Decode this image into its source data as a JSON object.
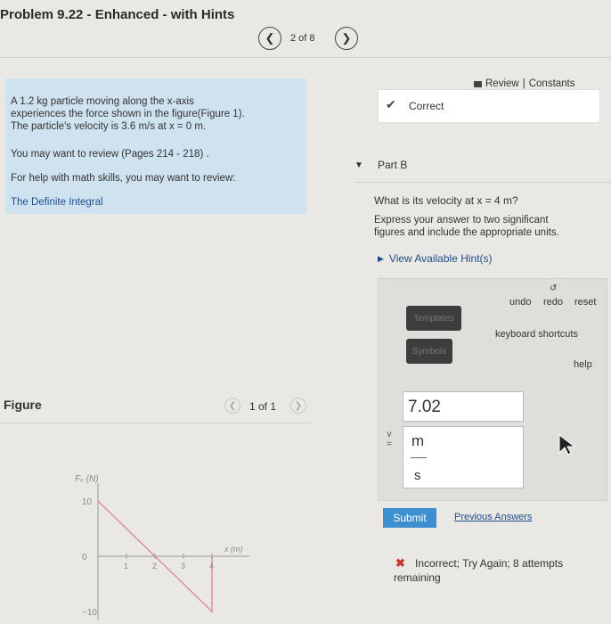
{
  "header": {
    "title": "Problem 9.22 - Enhanced - with Hints",
    "prev_icon": "chevron-left-icon",
    "next_icon": "chevron-right-icon",
    "page_indicator": "2 of 8"
  },
  "toplinks": {
    "review": "Review",
    "separator": "|",
    "constants": "Constants"
  },
  "problem": {
    "line1": "A 1.2 kg particle moving along the x-axis",
    "line2": "experiences the force shown in the figure(Figure 1).",
    "line3": "The particle's velocity is 3.6 m/s at x = 0 m.",
    "review_text": "You may want to review (Pages 214 - 218) .",
    "help_text": "For help with math skills, you may want to review:",
    "integral_link": "The Definite Integral"
  },
  "status_correct": {
    "icon": "checkmark-icon",
    "label": "Correct"
  },
  "part_b": {
    "label": "Part B",
    "question": "What is its velocity at x = 4 m?",
    "instructions_line1": "Express your answer to two significant",
    "instructions_line2": "figures and include the appropriate units.",
    "hints_link": "View Available Hint(s)"
  },
  "toolbar": {
    "templates": "Templates",
    "symbols": "Symbols",
    "undo": "undo",
    "redo": "redo",
    "reset": "reset",
    "keyboard": "keyboard shortcuts",
    "help": "help"
  },
  "answer": {
    "var_label": "v =",
    "value": "7.02",
    "unit_num": "m",
    "unit_den": "s"
  },
  "actions": {
    "submit": "Submit",
    "previous": "Previous Answers"
  },
  "feedback": {
    "icon": "x-icon",
    "line1": "Incorrect; Try Again; 8 attempts",
    "line2": "remaining"
  },
  "figure": {
    "label": "Figure",
    "counter": "1 of 1"
  },
  "chart_data": {
    "type": "line",
    "ylabel": "Fₓ (N)",
    "xlabel": "x (m)",
    "x": [
      0,
      4,
      4
    ],
    "y": [
      10,
      -10,
      0
    ],
    "xticks": [
      "1",
      "2",
      "3",
      "4"
    ],
    "yticks": [
      "10",
      "0",
      "−10"
    ],
    "xlim": [
      0,
      4.5
    ],
    "ylim": [
      -10,
      10
    ]
  }
}
